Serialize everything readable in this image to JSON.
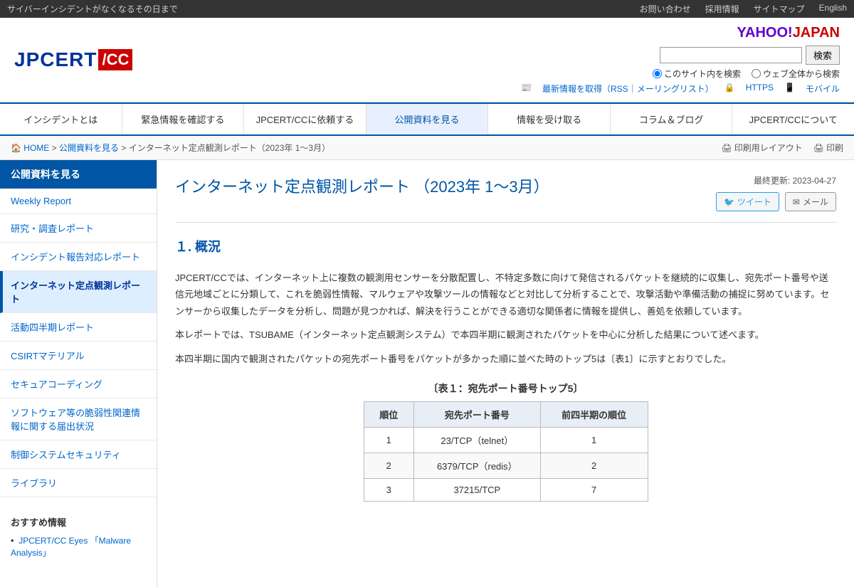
{
  "topbar": {
    "tagline": "サイバーインシデントがなくなるその日まで",
    "links": [
      {
        "label": "お問い合わせ",
        "id": "contact"
      },
      {
        "label": "採用情報",
        "id": "jobs"
      },
      {
        "label": "サイトマップ",
        "id": "sitemap"
      },
      {
        "label": "English",
        "id": "english"
      }
    ]
  },
  "header": {
    "logo_jpcert": "JPCERT",
    "logo_cc": "/CC",
    "yahoo_label": "YAHOO!JAPAN",
    "search_placeholder": "",
    "search_button": "検索",
    "search_site_label": "このサイト内を検索",
    "search_web_label": "ウェブ全体から検索",
    "update_rss": "最新情報を取得（RSS",
    "update_pipe": "｜",
    "update_mailing": "メーリングリスト）",
    "update_https": "HTTPS",
    "update_mobile": "モバイル"
  },
  "nav": {
    "items": [
      {
        "label": "インシデントとは",
        "id": "incident"
      },
      {
        "label": "緊急情報を確認する",
        "id": "emergency"
      },
      {
        "label": "JPCERT/CCに依頼する",
        "id": "request"
      },
      {
        "label": "公開資料を見る",
        "id": "publications",
        "active": true
      },
      {
        "label": "情報を受け取る",
        "id": "receive"
      },
      {
        "label": "コラム＆ブログ",
        "id": "blog"
      },
      {
        "label": "JPCERT/CCについて",
        "id": "about"
      }
    ]
  },
  "breadcrumb": {
    "home": "HOME",
    "level1": "公開資料を見る",
    "level2": "インターネット定点観測レポート（2023年 1〜3月）",
    "print_label": "印刷用レイアウト",
    "print2_label": "印刷"
  },
  "sidebar": {
    "category": "公開資料を見る",
    "items": [
      {
        "label": "Weekly Report",
        "id": "weekly-report",
        "active": false
      },
      {
        "label": "研究・調査レポート",
        "id": "research",
        "active": false
      },
      {
        "label": "インシデント報告対応レポート",
        "id": "incident-report",
        "active": false
      },
      {
        "label": "インターネット定点観測レポート",
        "id": "internet-report",
        "active": true
      },
      {
        "label": "活動四半期レポート",
        "id": "quarterly",
        "active": false
      },
      {
        "label": "CSIRTマテリアル",
        "id": "csirt",
        "active": false
      },
      {
        "label": "セキュアコーディング",
        "id": "secure-coding",
        "active": false
      },
      {
        "label": "ソフトウェア等の脆弱性関連情報に関する届出状況",
        "id": "vuln",
        "active": false
      },
      {
        "label": "制御システムセキュリティ",
        "id": "ics",
        "active": false
      },
      {
        "label": "ライブラリ",
        "id": "library",
        "active": false
      }
    ],
    "recommended_title": "おすすめ情報",
    "recommended_items": [
      {
        "label": "JPCERT/CC Eyes 「Malware Analysis」",
        "id": "rec1"
      }
    ]
  },
  "main": {
    "page_title": "インターネット定点観測レポート （2023年 1〜3月）",
    "last_updated_label": "最終更新: 2023-04-27",
    "share_tweet": "ツイート",
    "share_email": "メール",
    "section1_title": "１. 概況",
    "paragraph1": "JPCERT/CCでは、インターネット上に複数の観測用センサーを分散配置し、不特定多数に向けて発信されるパケットを継続的に収集し、宛先ポート番号や送信元地域ごとに分類して、これを脆弱性情報、マルウェアや攻撃ツールの情報などと対比して分析することで、攻撃活動や準備活動の捕捉に努めています。センサーから収集したデータを分析し、問題が見つかれば、解決を行うことができる適切な関係者に情報を提供し、善処を依頼しています。",
    "paragraph2": "本レポートでは、TSUBAME（インターネット定点観測システム）で本四半期に観測されたパケットを中心に分析した結果について述べます。",
    "paragraph3": "本四半期に国内で観測されたパケットの宛先ポート番号をパケットが多かった順に並べた時のトップ5は〔表1〕に示すとおりでした。",
    "table_title": "〔表１：宛先ポート番号トップ5〕",
    "table_headers": [
      "順位",
      "宛先ポート番号",
      "前四半期の順位"
    ],
    "table_rows": [
      {
        "rank": "1",
        "port": "23/TCP（telnet）",
        "prev": "1"
      },
      {
        "rank": "2",
        "port": "6379/TCP（redis）",
        "prev": "2"
      },
      {
        "rank": "3",
        "port": "37215/TCP",
        "prev": "7"
      }
    ]
  }
}
